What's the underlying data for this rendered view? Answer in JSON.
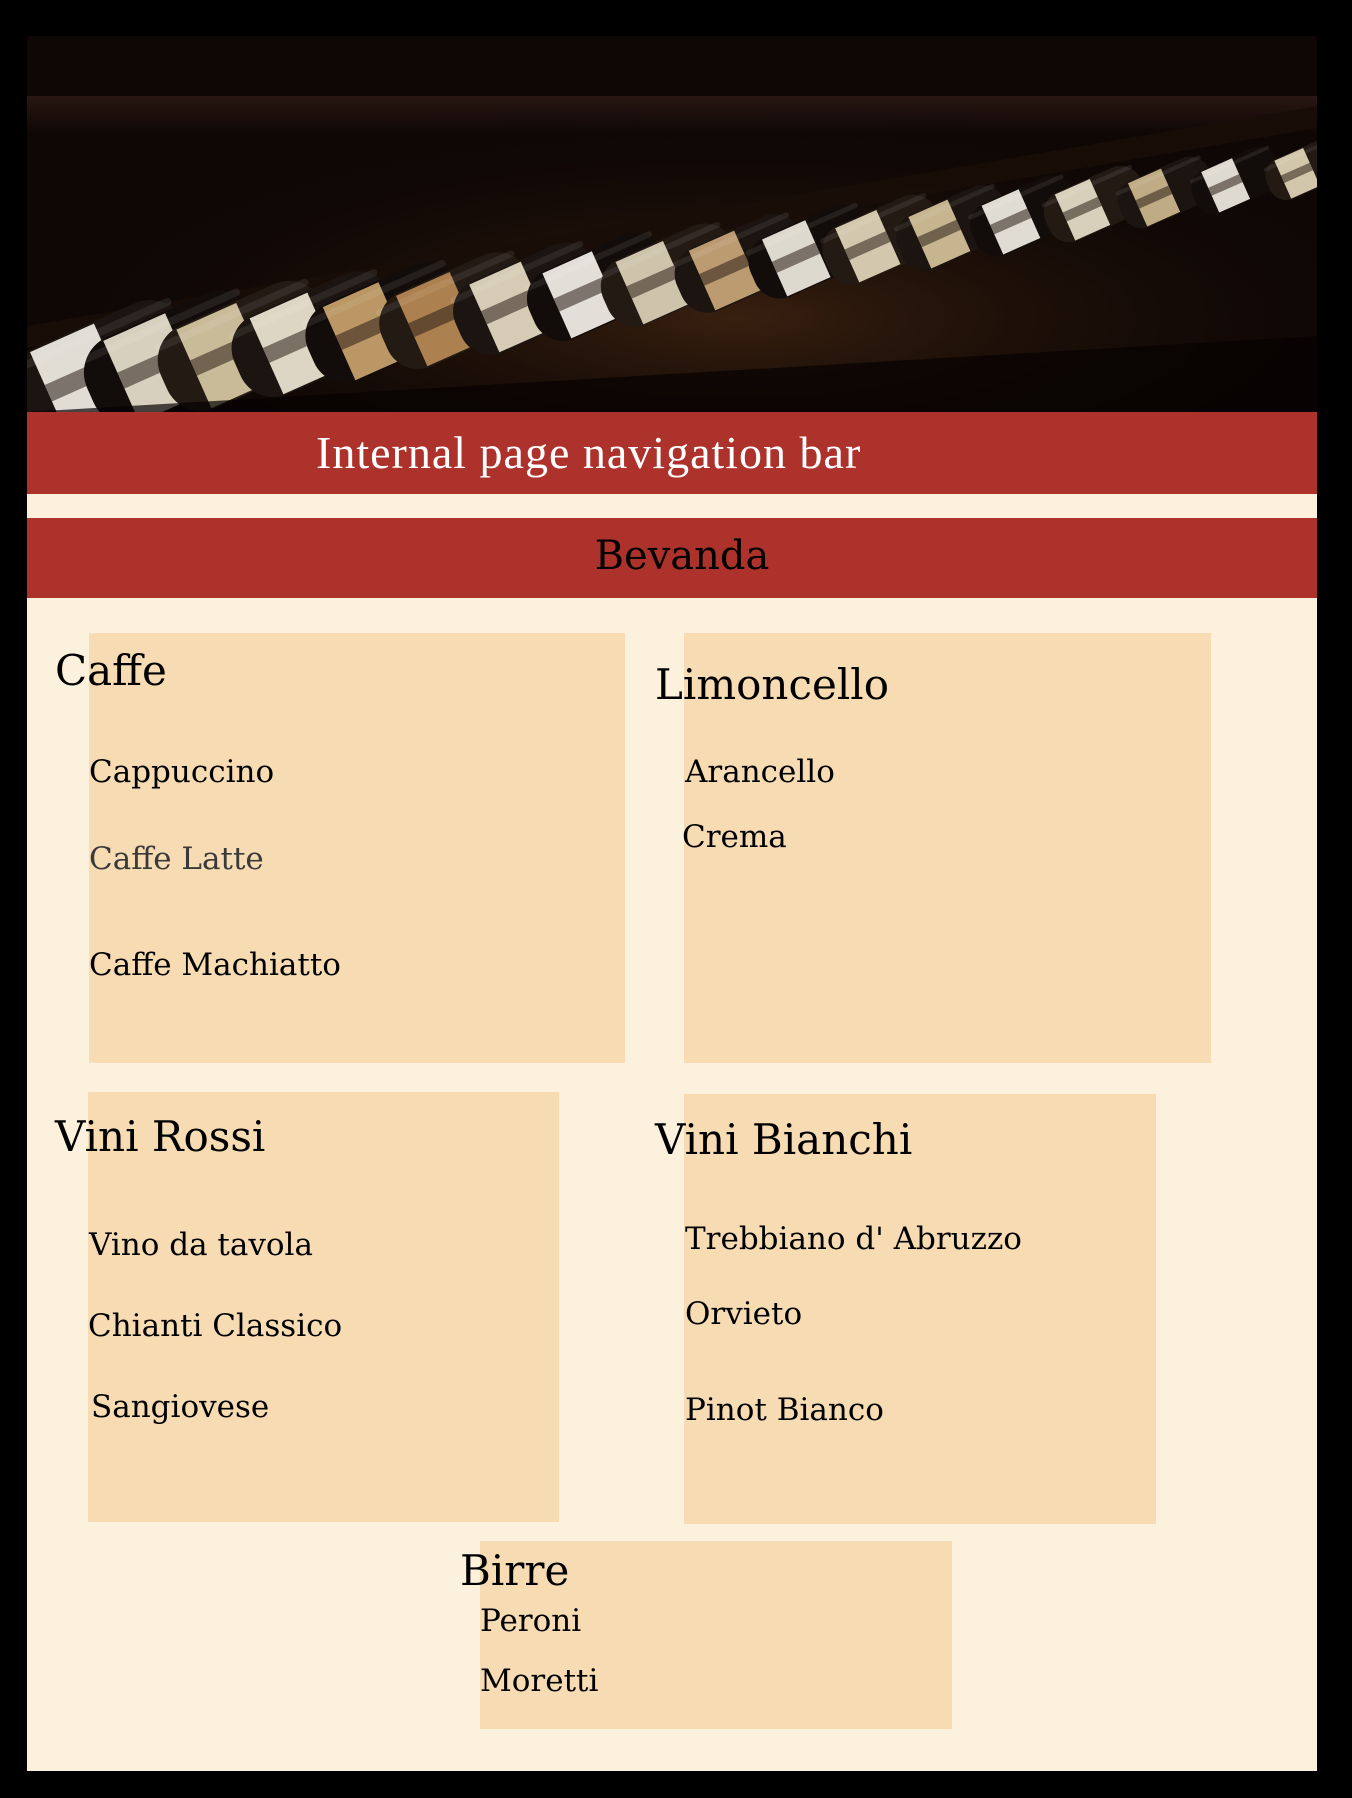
{
  "navbar": {
    "label": "Internal page navigation bar"
  },
  "section": {
    "title": "Bevanda"
  },
  "categories": {
    "caffe": {
      "title": "Caffe",
      "items": [
        "Cappuccino",
        "Caffe Latte",
        "Caffe Machiatto"
      ]
    },
    "limoncello": {
      "title": "Limoncello",
      "items": [
        "Arancello",
        "Crema"
      ]
    },
    "vini_rossi": {
      "title": "Vini Rossi",
      "items": [
        "Vino da tavola",
        "Chianti Classico",
        "Sangiovese"
      ]
    },
    "vini_bianchi": {
      "title": "Vini Bianchi",
      "items": [
        "Trebbiano d' Abruzzo",
        "Orvieto",
        "Pinot Bianco"
      ]
    },
    "birre": {
      "title": "Birre",
      "items": [
        "Peroni",
        "Moretti"
      ]
    }
  },
  "colors": {
    "frame": "#000000",
    "page_background": "#fcf1dc",
    "bar_red": "#ad322c",
    "box_tan": "#f7dcb3"
  }
}
